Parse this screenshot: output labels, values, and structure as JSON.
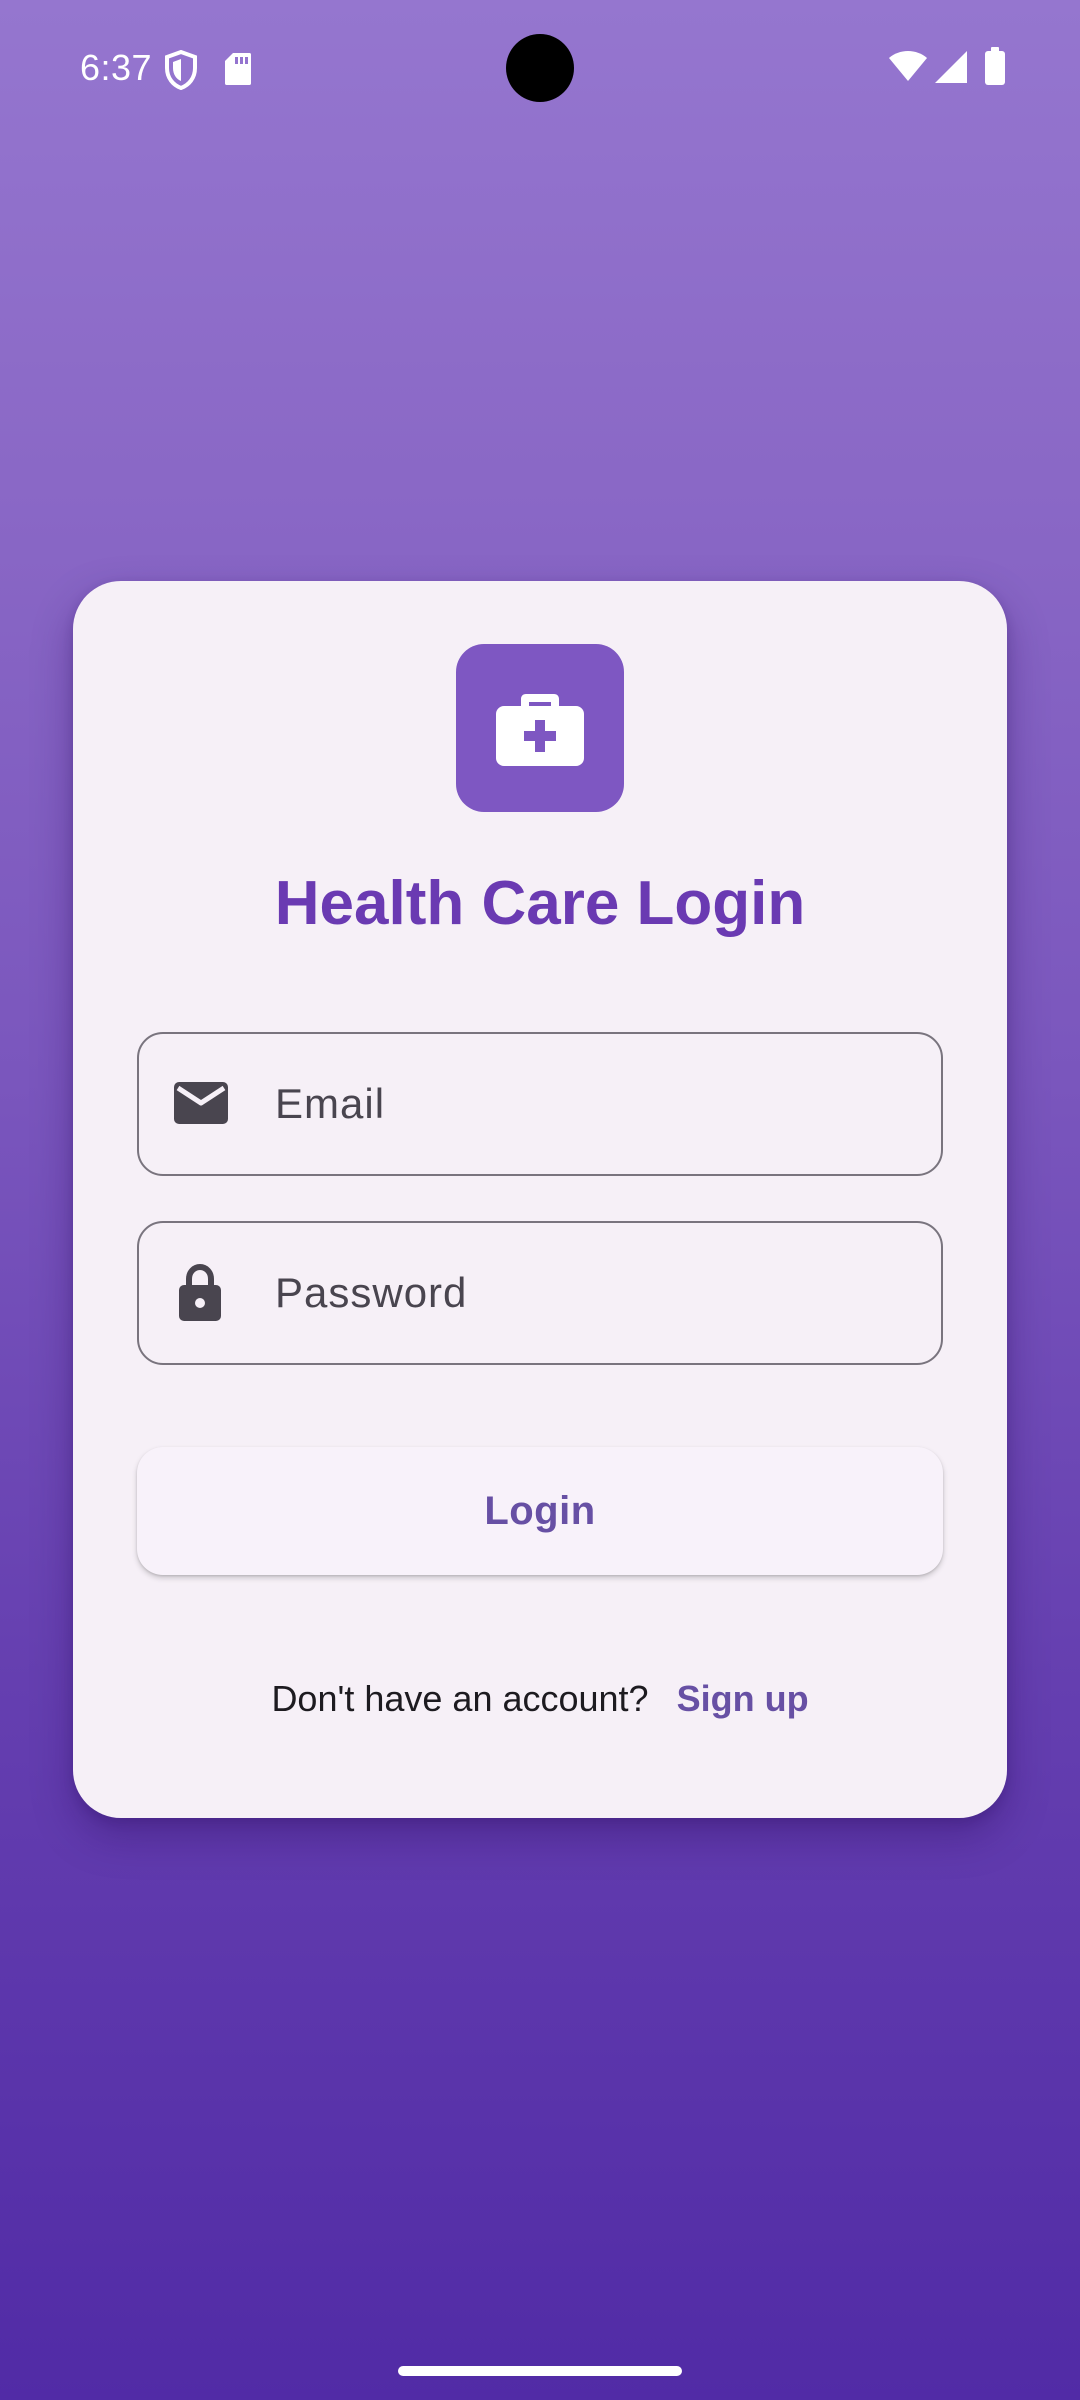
{
  "status_bar": {
    "time": "6:37",
    "left_icons": [
      "shield-icon",
      "sd-card-icon"
    ],
    "right_icons": [
      "wifi-icon",
      "signal-icon",
      "battery-icon"
    ]
  },
  "card": {
    "logo_icon": "medical-briefcase-icon",
    "title": "Health Care Login",
    "email_field": {
      "icon": "email-icon",
      "placeholder": "Email"
    },
    "password_field": {
      "icon": "lock-icon",
      "placeholder": "Password"
    },
    "login_button_label": "Login",
    "signup_prompt": "Don't have an account?",
    "signup_link": "Sign up"
  },
  "colors": {
    "accent": "#7e57c2",
    "title": "#6a3ab2",
    "link": "#6750a4",
    "card_bg": "#f6f0f7"
  }
}
